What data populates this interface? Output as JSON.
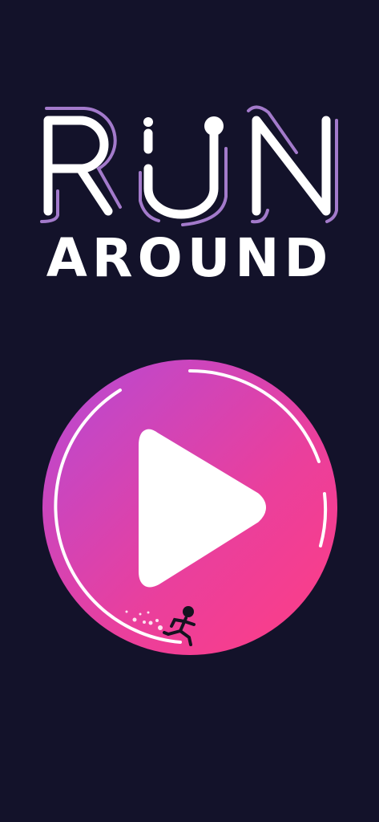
{
  "title": {
    "logo_word_top": "RUN",
    "logo_word_bottom": "AROUND"
  },
  "play_button": {
    "icon": "play-icon",
    "mascot": "running-stickman-icon"
  },
  "colors": {
    "background": "#13122a",
    "accent_purple": "#a77bd0",
    "gradient_start": "#b54ad6",
    "gradient_end": "#ff3d8a"
  }
}
